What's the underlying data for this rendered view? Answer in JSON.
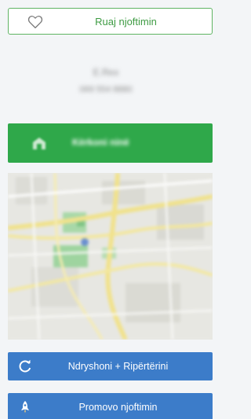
{
  "save_button": {
    "label": "Ruaj njoftimin",
    "icon": "heart-icon",
    "color": "#3e9b43"
  },
  "seller": {
    "name": "E.Rex",
    "phone": "069 554 8880"
  },
  "contact_bar": {
    "label": "Kërkoni ninë",
    "icon": "phone-icon",
    "color": "#2fa84a"
  },
  "map": {
    "description_icon": "map-icon"
  },
  "actions": {
    "edit_label": "Ndryshoni + Ripërtërini",
    "edit_icon": "refresh-icon",
    "promote_label": "Promovo njoftimin",
    "promote_icon": "rocket-icon",
    "color": "#3c7cc9"
  }
}
